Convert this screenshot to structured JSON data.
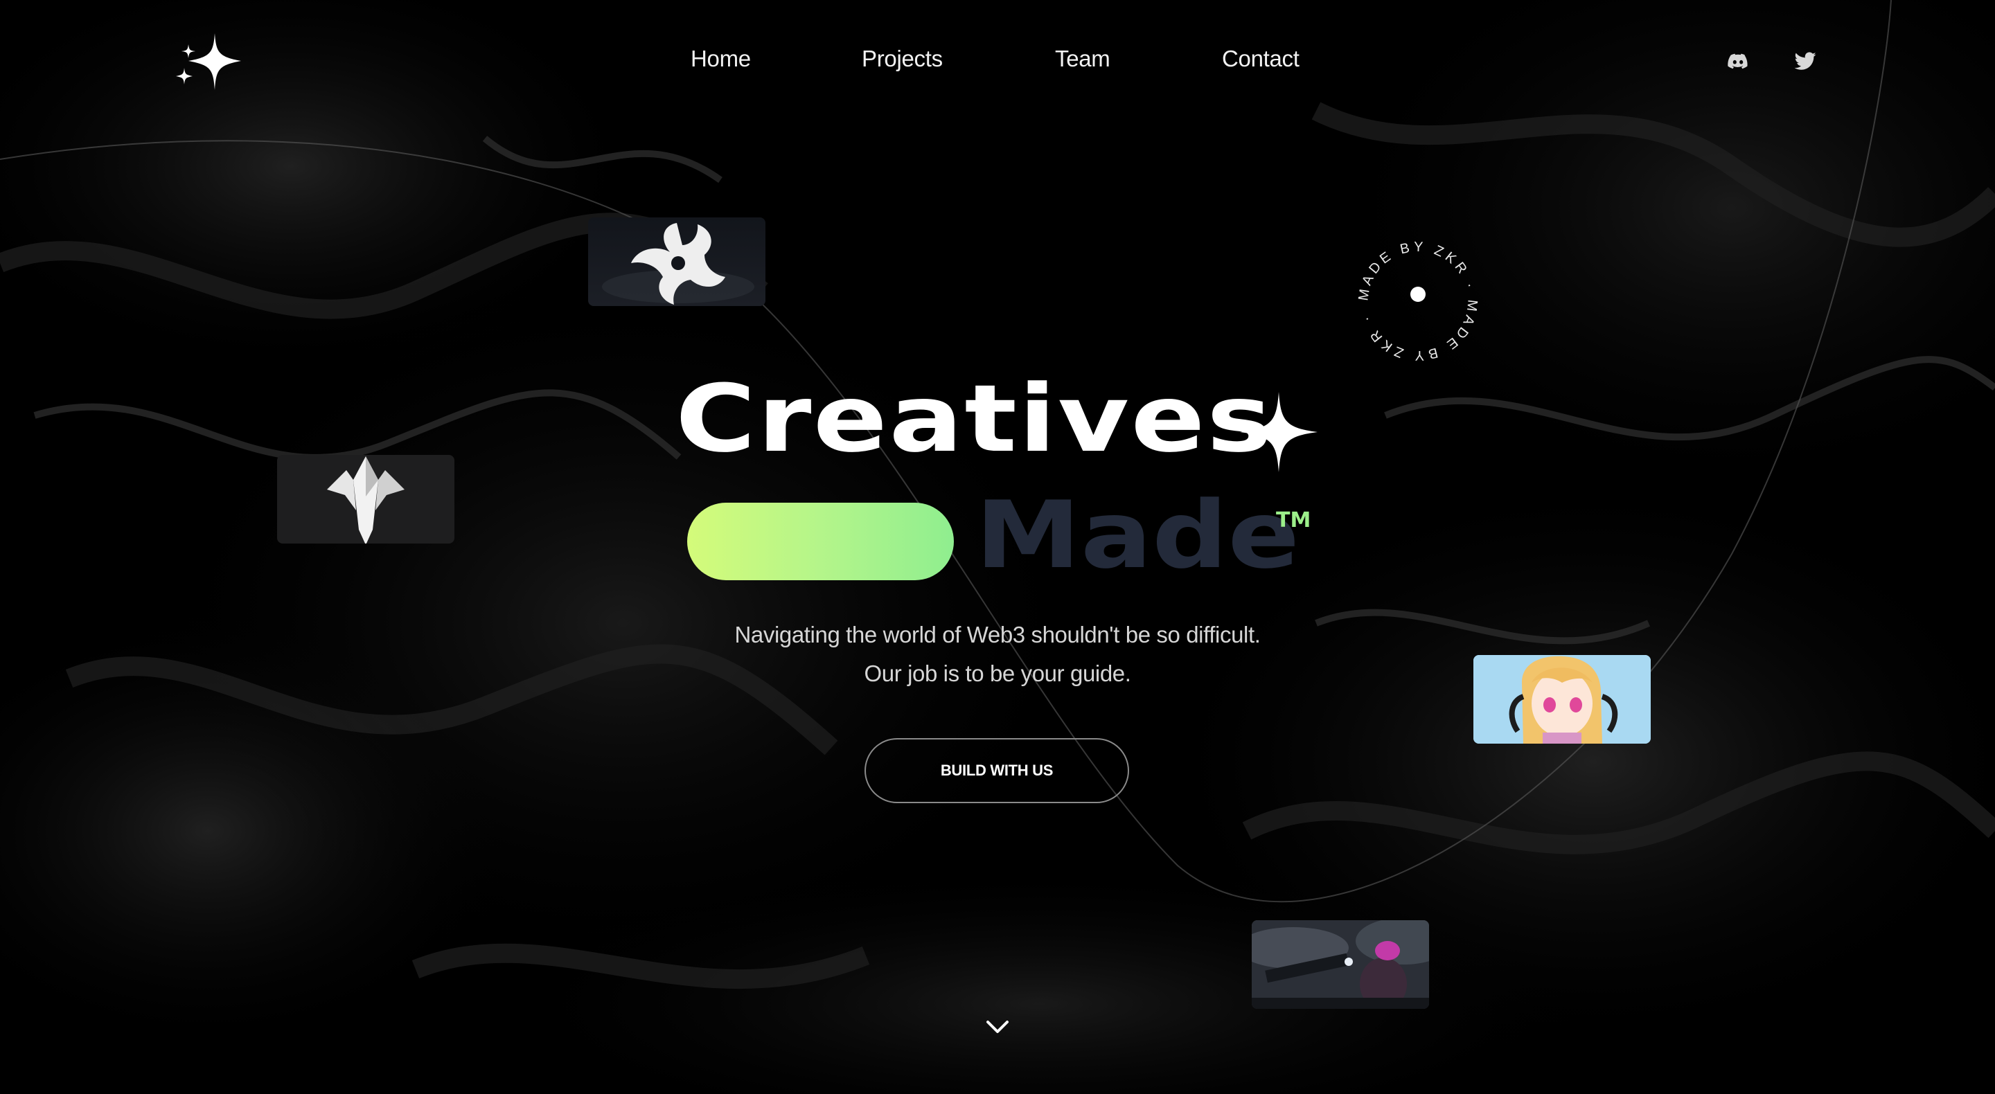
{
  "nav": {
    "links": [
      {
        "label": "Home"
      },
      {
        "label": "Projects"
      },
      {
        "label": "Team"
      },
      {
        "label": "Contact"
      }
    ],
    "social": [
      {
        "icon": "discord-icon"
      },
      {
        "icon": "twitter-icon"
      }
    ]
  },
  "hero": {
    "title": "Creatives",
    "title_suffix": "Made",
    "trademark": "TM",
    "subtitle_line1": "Navigating the world of Web3 shouldn't be so difficult.",
    "subtitle_line2": "Our job is to be your guide.",
    "cta_label": "BUILD WITH US"
  },
  "badge": {
    "ring_text": "MADE BY ZKR · MADE BY ZKR ·"
  },
  "colors": {
    "background": "#000000",
    "accent_start": "#d4fb7a",
    "accent_end": "#8fee8f",
    "muted_word": "#232a3a"
  }
}
